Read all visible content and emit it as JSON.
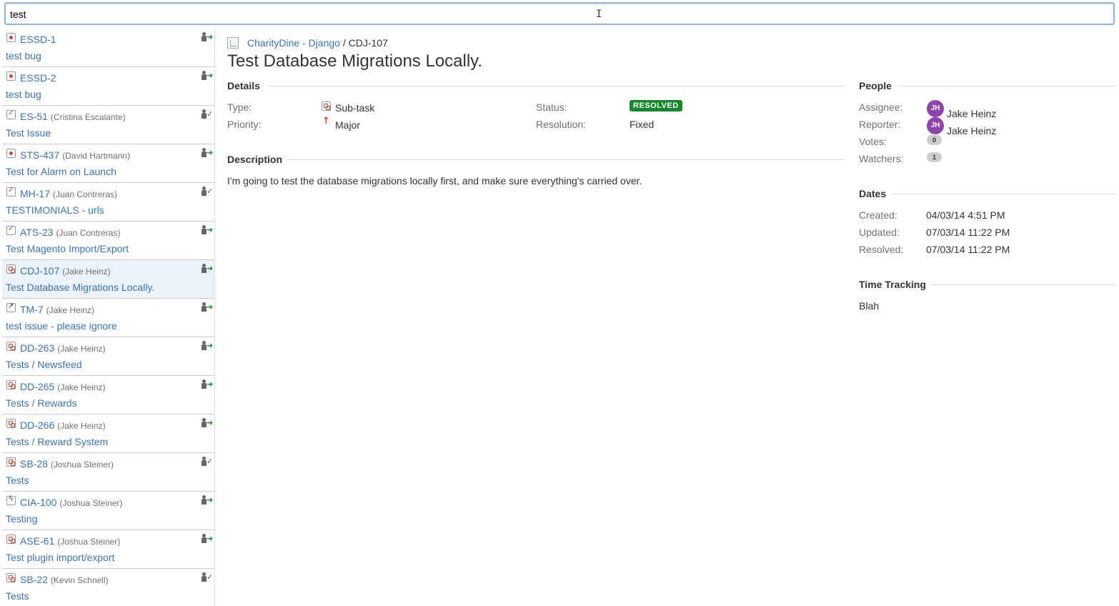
{
  "search": {
    "value": "test",
    "placeholder": ""
  },
  "results": [
    {
      "type": "bug",
      "key": "ESSD-1",
      "user": "",
      "summary": "test bug",
      "action": "assign"
    },
    {
      "type": "bug",
      "key": "ESSD-2",
      "user": "",
      "summary": "test bug",
      "action": "assign"
    },
    {
      "type": "task",
      "key": "ES-51",
      "user": "(Cristina Escalante)",
      "summary": "Test Issue",
      "action": "resolved"
    },
    {
      "type": "bug",
      "key": "STS-437",
      "user": "(David Hartmann)",
      "summary": "Test for Alarm on Launch",
      "action": "move"
    },
    {
      "type": "task",
      "key": "MH-17",
      "user": "(Juan Contreras)",
      "summary": "TESTIMONIALS - urls",
      "action": "resolved"
    },
    {
      "type": "task",
      "key": "ATS-23",
      "user": "(Juan Contreras)",
      "summary": "Test Magento Import/Export",
      "action": "assign"
    },
    {
      "type": "subtask",
      "key": "CDJ-107",
      "user": "(Jake Heinz)",
      "summary": "Test Database Migrations Locally.",
      "action": "assign",
      "selected": true
    },
    {
      "type": "improve",
      "key": "TM-7",
      "user": "(Jake Heinz)",
      "summary": "test issue - please ignore",
      "action": "assign"
    },
    {
      "type": "subtask",
      "key": "DD-263",
      "user": "(Jake Heinz)",
      "summary": "Tests / Newsfeed",
      "action": "assign"
    },
    {
      "type": "subtask",
      "key": "DD-265",
      "user": "(Jake Heinz)",
      "summary": "Tests / Rewards",
      "action": "assign"
    },
    {
      "type": "subtask",
      "key": "DD-266",
      "user": "(Jake Heinz)",
      "summary": "Tests / Reward System",
      "action": "assign"
    },
    {
      "type": "subtask",
      "key": "SB-28",
      "user": "(Joshua Steiner)",
      "summary": "Tests",
      "action": "resolved"
    },
    {
      "type": "epic",
      "key": "CIA-100",
      "user": "(Joshua Steiner)",
      "summary": "Testing",
      "action": "move"
    },
    {
      "type": "subtask",
      "key": "ASE-61",
      "user": "(Joshua Steiner)",
      "summary": "Test plugin import/export",
      "action": "assign"
    },
    {
      "type": "subtask",
      "key": "SB-22",
      "user": "(Kevin Schnell)",
      "summary": "Tests",
      "action": "resolved"
    }
  ],
  "issue": {
    "project": "CharityDine - Django",
    "separator": "/",
    "key": "CDJ-107",
    "title": "Test Database Migrations Locally.",
    "details_heading": "Details",
    "type_label": "Type:",
    "type_value": "Sub-task",
    "priority_label": "Priority:",
    "priority_value": "Major",
    "status_label": "Status:",
    "status_value": "RESOLVED",
    "resolution_label": "Resolution:",
    "resolution_value": "Fixed",
    "description_heading": "Description",
    "description": "I'm going to test the database migrations locally first, and make sure everything's carried over."
  },
  "people": {
    "heading": "People",
    "assignee_label": "Assignee:",
    "assignee_initials": "JH",
    "assignee_name": "Jake Heinz",
    "reporter_label": "Reporter:",
    "reporter_initials": "JH",
    "reporter_name": "Jake Heinz",
    "votes_label": "Votes:",
    "votes_count": "0",
    "watchers_label": "Watchers:",
    "watchers_count": "1"
  },
  "dates": {
    "heading": "Dates",
    "created_label": "Created:",
    "created_value": "04/03/14 4:51 PM",
    "updated_label": "Updated:",
    "updated_value": "07/03/14 11:22 PM",
    "resolved_label": "Resolved:",
    "resolved_value": "07/03/14 11:22 PM"
  },
  "time_tracking": {
    "heading": "Time Tracking",
    "value": "Blah"
  },
  "colors": {
    "link": "#3b73af",
    "status_resolved": "#14892c",
    "avatar": "#8e44ad",
    "selected_row": "#ebf2f9"
  },
  "icons": {
    "search_cursor": "text-cursor-icon",
    "bug": "bug-icon",
    "task": "task-icon",
    "subtask": "subtask-icon",
    "improvement": "improvement-icon",
    "epic": "epic-icon",
    "assign": "assign-to-me-icon",
    "priority": "priority-major-icon"
  }
}
